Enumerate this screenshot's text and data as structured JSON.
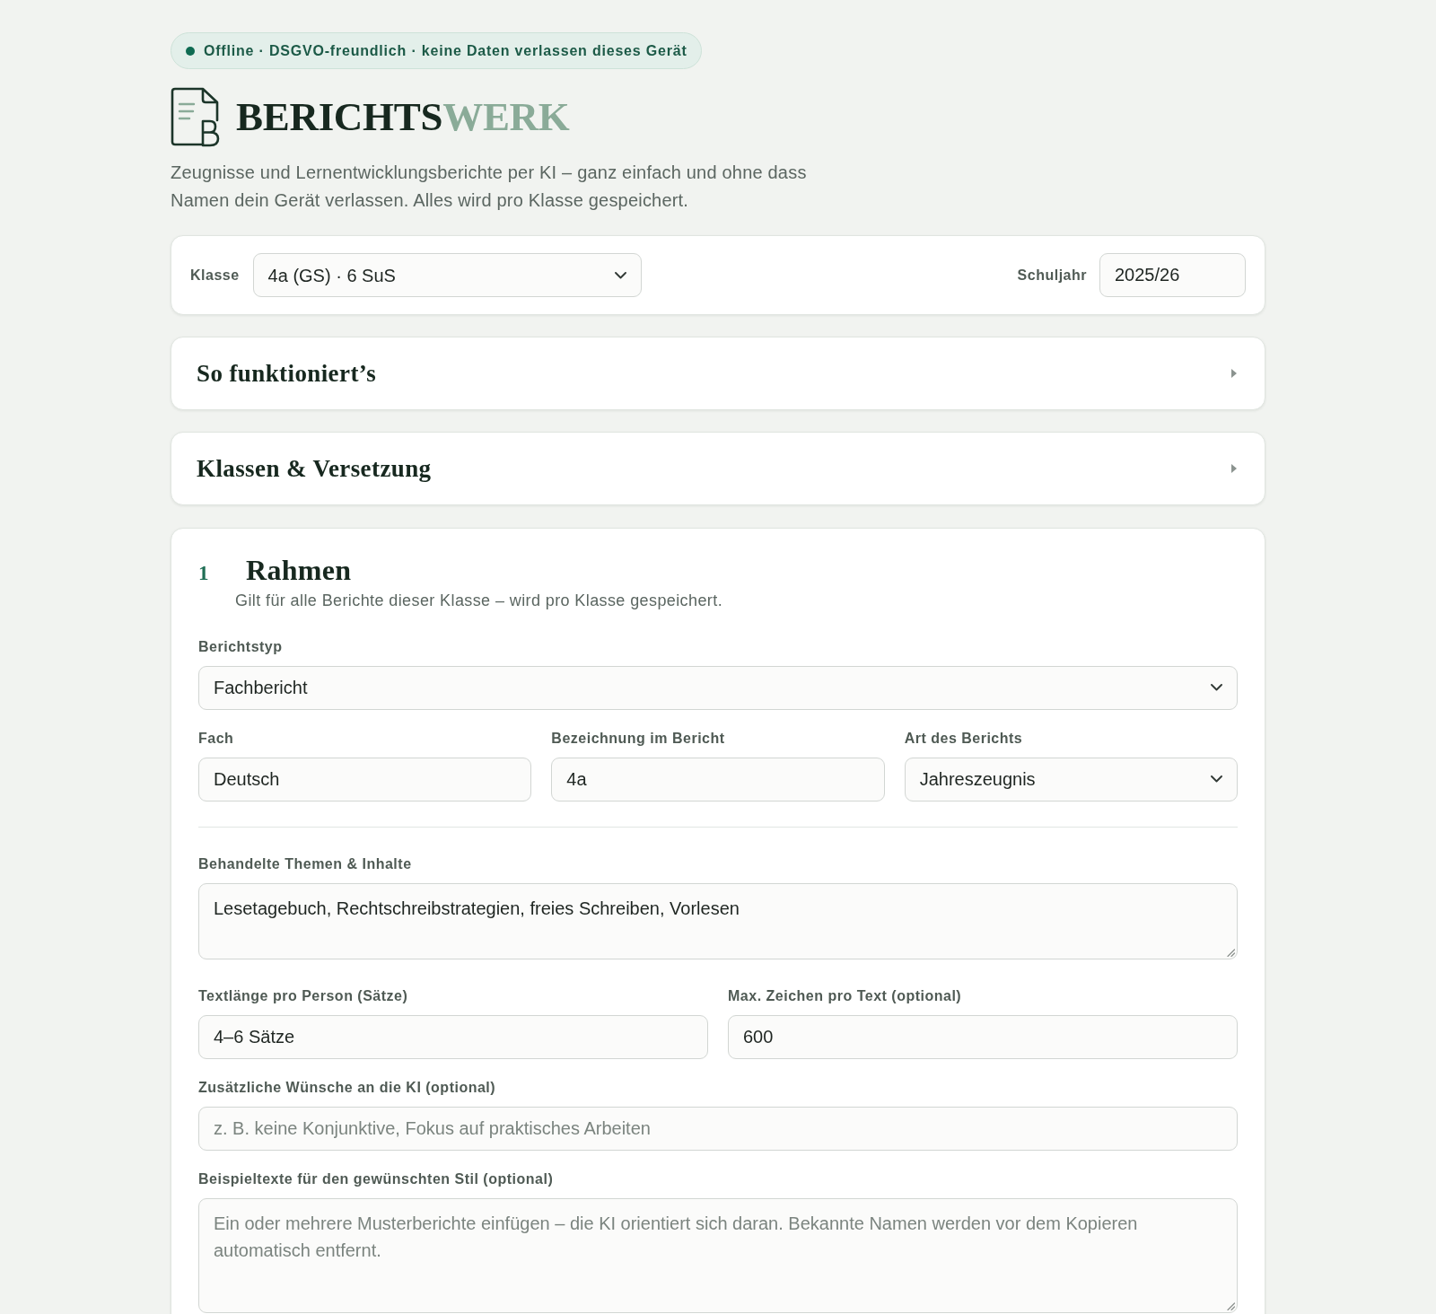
{
  "status_badge": {
    "text": "Offline · DSGVO-freundlich · keine Daten verlassen dieses Gerät"
  },
  "brand": {
    "title_parts": [
      {
        "text": "BERICHTS",
        "color": "#17281f"
      },
      {
        "text": "WERK",
        "color": "#8aab98"
      }
    ],
    "tagline": "Zeugnisse und Lernentwicklungsberichte per KI – ganz einfach und ohne dass Namen dein Gerät verlassen. Alles wird pro Klasse gespeichert."
  },
  "class_bar": {
    "class_label": "Klasse",
    "class_value": "4a (GS) · 6 SuS",
    "year_label": "Schuljahr",
    "year_value": "2025/26"
  },
  "collapsibles": [
    {
      "title": "So funktioniert’s",
      "expanded": false
    },
    {
      "title": "Klassen & Versetzung",
      "expanded": false
    }
  ],
  "step": {
    "number": "1",
    "title": "Rahmen",
    "subtitle": "Gilt für alle Berichte dieser Klasse – wird pro Klasse gespeichert.",
    "rows": [
      {
        "kind": "fields",
        "fields": [
          {
            "kind": "select",
            "label": "Berichtstyp",
            "value": "Fachbericht"
          }
        ]
      },
      {
        "kind": "fields",
        "fields": [
          {
            "kind": "input",
            "label": "Fach",
            "value": "Deutsch"
          },
          {
            "kind": "input",
            "label": "Bezeichnung im Bericht",
            "value": "4a"
          },
          {
            "kind": "select",
            "label": "Art des Berichts",
            "value": "Jahreszeugnis"
          }
        ]
      },
      {
        "kind": "divider"
      },
      {
        "kind": "fields",
        "fields": [
          {
            "kind": "textarea",
            "label": "Behandelte Themen & Inhalte",
            "value": "Lesetagebuch, Rechtschreibstrategien, freies Schreiben, Vorlesen"
          }
        ]
      },
      {
        "kind": "fields",
        "fields": [
          {
            "kind": "input",
            "label": "Textlänge pro Person (Sätze)",
            "value": "4–6 Sätze"
          },
          {
            "kind": "input",
            "label": "Max. Zeichen pro Text (optional)",
            "value": "600"
          }
        ]
      },
      {
        "kind": "fields",
        "fields": [
          {
            "kind": "input",
            "label": "Zusätzliche Wünsche an die KI (optional)",
            "placeholder": "z. B. keine Konjunktive, Fokus auf praktisches Arbeiten"
          }
        ]
      },
      {
        "kind": "fields",
        "fields": [
          {
            "kind": "textarea",
            "label": "Beispieltexte für den gewünschten Stil (optional)",
            "placeholder": "Ein oder mehrere Musterberichte einfügen – die KI orientiert sich daran. Bekannte Namen werden vor dem Kopieren automatisch entfernt."
          }
        ]
      }
    ]
  }
}
